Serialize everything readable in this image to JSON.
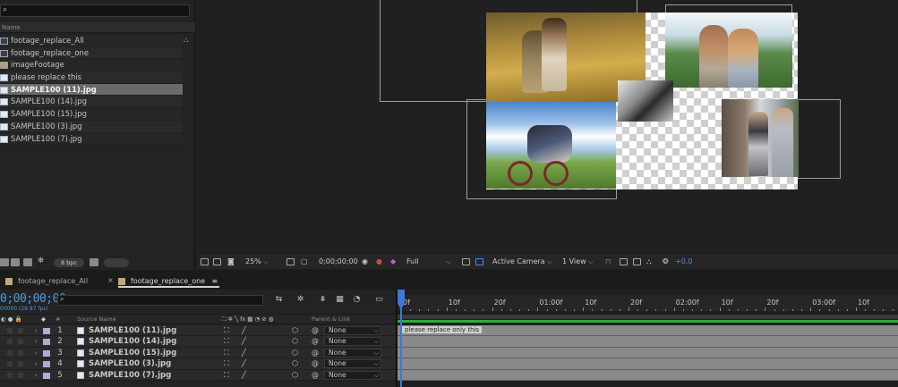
{
  "project": {
    "search_icon": "⌕",
    "column_name": "Name",
    "items": [
      {
        "name": "footage_replace_All",
        "type": "comp"
      },
      {
        "name": "footage_replace_one",
        "type": "comp"
      },
      {
        "name": "imageFootage",
        "type": "folder"
      },
      {
        "name": "please replace this",
        "type": "file"
      },
      {
        "name": "SAMPLE100 (11).jpg",
        "type": "file",
        "selected": true
      },
      {
        "name": "SAMPLE100 (14).jpg",
        "type": "file"
      },
      {
        "name": "SAMPLE100 (15).jpg",
        "type": "file"
      },
      {
        "name": "SAMPLE100 (3).jpg",
        "type": "file"
      },
      {
        "name": "SAMPLE100 (7).jpg",
        "type": "file"
      }
    ],
    "bpc": "8 bpc"
  },
  "viewer_toolbar": {
    "zoom": "25%",
    "timecode": "0;00;00;00",
    "resolution": "Full",
    "camera": "Active Camera",
    "views": "1 View",
    "exposure": "+0.0"
  },
  "timeline": {
    "tabs": [
      {
        "label": "footage_replace_All",
        "active": false
      },
      {
        "label": "footage_replace_one",
        "active": true
      }
    ],
    "timecode": "0;00;00;00",
    "fps": "00000 (29.97 fps)",
    "columns": {
      "num": "#",
      "source_name": "Source Name",
      "parent_link": "Parent & Link"
    },
    "layers": [
      {
        "num": "1",
        "name": "SAMPLE100 (11).jpg",
        "parent": "None"
      },
      {
        "num": "2",
        "name": "SAMPLE100 (14).jpg",
        "parent": "None"
      },
      {
        "num": "3",
        "name": "SAMPLE100 (15).jpg",
        "parent": "None"
      },
      {
        "num": "4",
        "name": "SAMPLE100 (3).jpg",
        "parent": "None"
      },
      {
        "num": "5",
        "name": "SAMPLE100 (7).jpg",
        "parent": "None"
      }
    ],
    "ruler_labels": [
      "0f",
      "10f",
      "20f",
      "01:00f",
      "10f",
      "20f",
      "02:00f",
      "10f",
      "20f",
      "03:00f",
      "10f",
      "20"
    ],
    "marker_comment": "please replace only this"
  },
  "colors": {
    "accent_blue": "#4a9be8",
    "playhead": "#3c78d8",
    "work_bar": "#2eaa40",
    "selection": "#6a6a6a"
  }
}
